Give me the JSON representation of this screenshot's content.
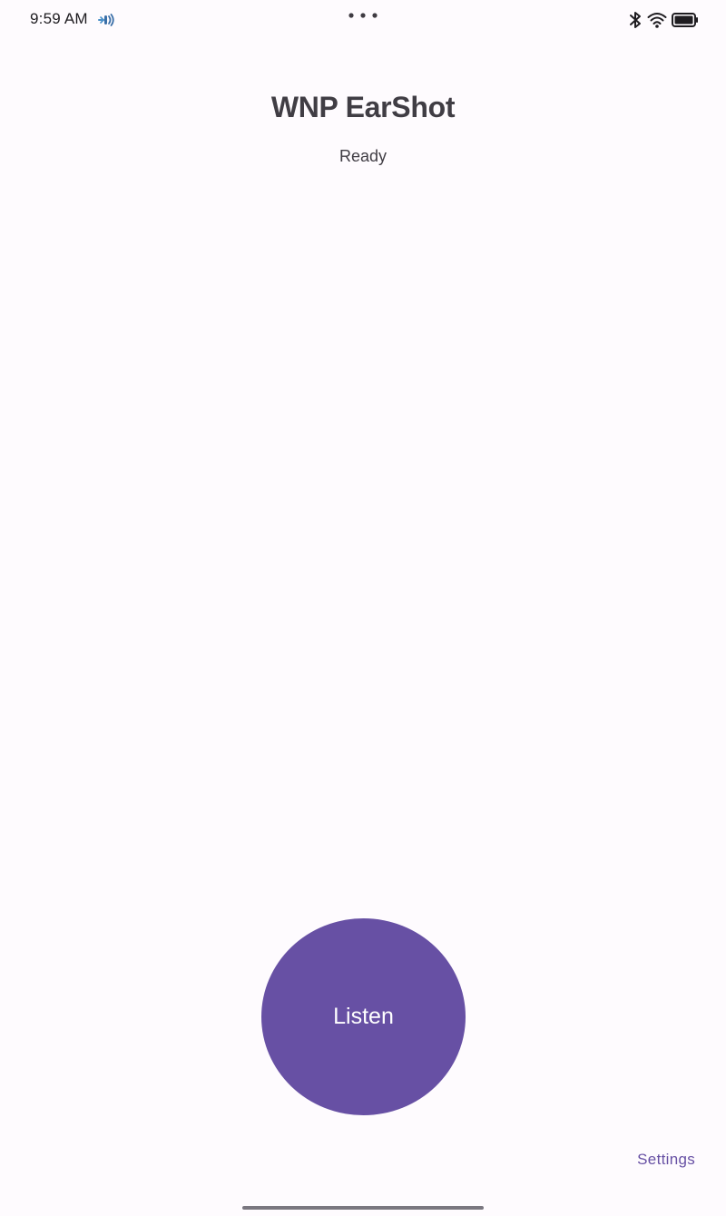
{
  "status_bar": {
    "time": "9:59 AM",
    "icons": [
      "hearing-icon",
      "more-dots-icon",
      "bluetooth-icon",
      "wifi-icon",
      "battery-icon"
    ]
  },
  "main": {
    "title": "WNP EarShot",
    "status": "Ready"
  },
  "actions": {
    "listen_label": "Listen",
    "settings_label": "Settings"
  },
  "colors": {
    "background": "#fefbfe",
    "accent": "#6750a4",
    "text": "#403d44"
  }
}
